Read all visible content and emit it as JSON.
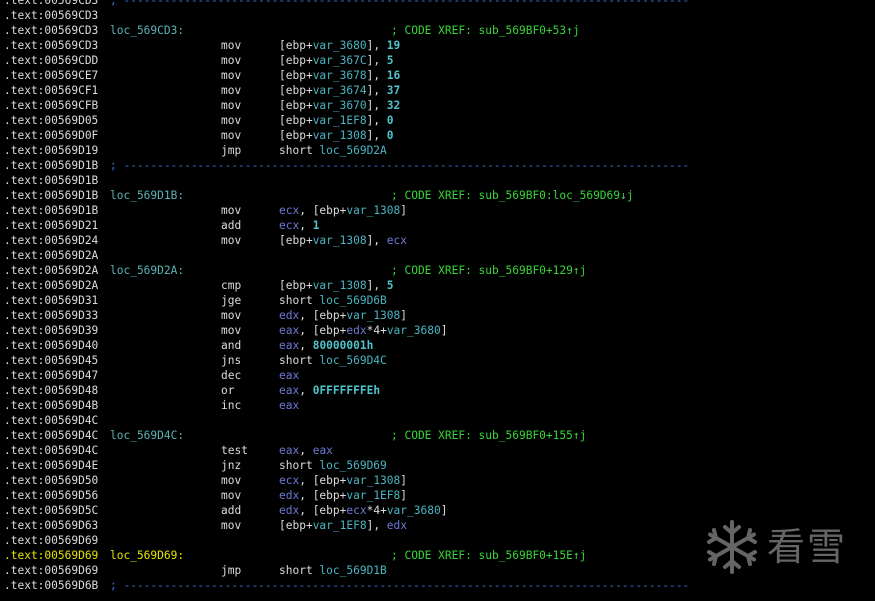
{
  "colors": {
    "background": "#000000",
    "address": "#dcdcdc",
    "address_highlight": "#e5e500",
    "label": "#5cb2b5",
    "comment": "#38d438",
    "separator": "#3b6fd1",
    "variable": "#4ab4c0",
    "number": "#4fc3c9",
    "register": "#6f78d6"
  },
  "separator_text": "; ------------------------------------------------------------------------------------",
  "lines": [
    {
      "addr": ".text:00569CD3",
      "sep": true
    },
    {
      "addr": ".text:00569CD3"
    },
    {
      "addr": ".text:00569CD3",
      "label": "loc_569CD3:",
      "comment": "; CODE XREF: sub_569BF0+53↑j"
    },
    {
      "addr": ".text:00569CD3",
      "mnem": "mov",
      "ops": [
        [
          "t-txt",
          "[ebp+"
        ],
        [
          "t-var",
          "var_3680"
        ],
        [
          "t-txt",
          "], "
        ],
        [
          "t-num",
          "19"
        ]
      ]
    },
    {
      "addr": ".text:00569CDD",
      "mnem": "mov",
      "ops": [
        [
          "t-txt",
          "[ebp+"
        ],
        [
          "t-var",
          "var_367C"
        ],
        [
          "t-txt",
          "], "
        ],
        [
          "t-num",
          "5"
        ]
      ]
    },
    {
      "addr": ".text:00569CE7",
      "mnem": "mov",
      "ops": [
        [
          "t-txt",
          "[ebp+"
        ],
        [
          "t-var",
          "var_3678"
        ],
        [
          "t-txt",
          "], "
        ],
        [
          "t-num",
          "16"
        ]
      ]
    },
    {
      "addr": ".text:00569CF1",
      "mnem": "mov",
      "ops": [
        [
          "t-txt",
          "[ebp+"
        ],
        [
          "t-var",
          "var_3674"
        ],
        [
          "t-txt",
          "], "
        ],
        [
          "t-num",
          "37"
        ]
      ]
    },
    {
      "addr": ".text:00569CFB",
      "mnem": "mov",
      "ops": [
        [
          "t-txt",
          "[ebp+"
        ],
        [
          "t-var",
          "var_3670"
        ],
        [
          "t-txt",
          "], "
        ],
        [
          "t-num",
          "32"
        ]
      ]
    },
    {
      "addr": ".text:00569D05",
      "mnem": "mov",
      "ops": [
        [
          "t-txt",
          "[ebp+"
        ],
        [
          "t-var",
          "var_1EF8"
        ],
        [
          "t-txt",
          "], "
        ],
        [
          "t-num",
          "0"
        ]
      ]
    },
    {
      "addr": ".text:00569D0F",
      "mnem": "mov",
      "ops": [
        [
          "t-txt",
          "[ebp+"
        ],
        [
          "t-var",
          "var_1308"
        ],
        [
          "t-txt",
          "], "
        ],
        [
          "t-num",
          "0"
        ]
      ]
    },
    {
      "addr": ".text:00569D19",
      "mnem": "jmp",
      "ops": [
        [
          "t-txt",
          "short "
        ],
        [
          "t-loc",
          "loc_569D2A"
        ]
      ]
    },
    {
      "addr": ".text:00569D1B",
      "sep": true
    },
    {
      "addr": ".text:00569D1B"
    },
    {
      "addr": ".text:00569D1B",
      "label": "loc_569D1B:",
      "comment": "; CODE XREF: sub_569BF0:loc_569D69↓j"
    },
    {
      "addr": ".text:00569D1B",
      "mnem": "mov",
      "ops": [
        [
          "t-reg",
          "ecx"
        ],
        [
          "t-txt",
          ", [ebp+"
        ],
        [
          "t-var",
          "var_1308"
        ],
        [
          "t-txt",
          "]"
        ]
      ]
    },
    {
      "addr": ".text:00569D21",
      "mnem": "add",
      "ops": [
        [
          "t-reg",
          "ecx"
        ],
        [
          "t-txt",
          ", "
        ],
        [
          "t-num",
          "1"
        ]
      ]
    },
    {
      "addr": ".text:00569D24",
      "mnem": "mov",
      "ops": [
        [
          "t-txt",
          "[ebp+"
        ],
        [
          "t-var",
          "var_1308"
        ],
        [
          "t-txt",
          "], "
        ],
        [
          "t-reg",
          "ecx"
        ]
      ]
    },
    {
      "addr": ".text:00569D2A"
    },
    {
      "addr": ".text:00569D2A",
      "label": "loc_569D2A:",
      "comment": "; CODE XREF: sub_569BF0+129↑j"
    },
    {
      "addr": ".text:00569D2A",
      "mnem": "cmp",
      "ops": [
        [
          "t-txt",
          "[ebp+"
        ],
        [
          "t-var",
          "var_1308"
        ],
        [
          "t-txt",
          "], "
        ],
        [
          "t-num",
          "5"
        ]
      ]
    },
    {
      "addr": ".text:00569D31",
      "mnem": "jge",
      "ops": [
        [
          "t-txt",
          "short "
        ],
        [
          "t-loc",
          "loc_569D6B"
        ]
      ]
    },
    {
      "addr": ".text:00569D33",
      "mnem": "mov",
      "ops": [
        [
          "t-reg",
          "edx"
        ],
        [
          "t-txt",
          ", [ebp+"
        ],
        [
          "t-var",
          "var_1308"
        ],
        [
          "t-txt",
          "]"
        ]
      ]
    },
    {
      "addr": ".text:00569D39",
      "mnem": "mov",
      "ops": [
        [
          "t-reg",
          "eax"
        ],
        [
          "t-txt",
          ", [ebp+"
        ],
        [
          "t-reg",
          "edx"
        ],
        [
          "t-txt",
          "*4+"
        ],
        [
          "t-var",
          "var_3680"
        ],
        [
          "t-txt",
          "]"
        ]
      ]
    },
    {
      "addr": ".text:00569D40",
      "mnem": "and",
      "ops": [
        [
          "t-reg",
          "eax"
        ],
        [
          "t-txt",
          ", "
        ],
        [
          "t-num",
          "80000001h"
        ]
      ]
    },
    {
      "addr": ".text:00569D45",
      "mnem": "jns",
      "ops": [
        [
          "t-txt",
          "short "
        ],
        [
          "t-loc",
          "loc_569D4C"
        ]
      ]
    },
    {
      "addr": ".text:00569D47",
      "mnem": "dec",
      "ops": [
        [
          "t-reg",
          "eax"
        ]
      ]
    },
    {
      "addr": ".text:00569D48",
      "mnem": "or",
      "ops": [
        [
          "t-reg",
          "eax"
        ],
        [
          "t-txt",
          ", "
        ],
        [
          "t-num",
          "0FFFFFFFEh"
        ]
      ]
    },
    {
      "addr": ".text:00569D4B",
      "mnem": "inc",
      "ops": [
        [
          "t-reg",
          "eax"
        ]
      ]
    },
    {
      "addr": ".text:00569D4C"
    },
    {
      "addr": ".text:00569D4C",
      "label": "loc_569D4C:",
      "comment": "; CODE XREF: sub_569BF0+155↑j"
    },
    {
      "addr": ".text:00569D4C",
      "mnem": "test",
      "ops": [
        [
          "t-reg",
          "eax"
        ],
        [
          "t-txt",
          ", "
        ],
        [
          "t-reg",
          "eax"
        ]
      ]
    },
    {
      "addr": ".text:00569D4E",
      "mnem": "jnz",
      "ops": [
        [
          "t-txt",
          "short "
        ],
        [
          "t-loc",
          "loc_569D69"
        ]
      ]
    },
    {
      "addr": ".text:00569D50",
      "mnem": "mov",
      "ops": [
        [
          "t-reg",
          "ecx"
        ],
        [
          "t-txt",
          ", [ebp+"
        ],
        [
          "t-var",
          "var_1308"
        ],
        [
          "t-txt",
          "]"
        ]
      ]
    },
    {
      "addr": ".text:00569D56",
      "mnem": "mov",
      "ops": [
        [
          "t-reg",
          "edx"
        ],
        [
          "t-txt",
          ", [ebp+"
        ],
        [
          "t-var",
          "var_1EF8"
        ],
        [
          "t-txt",
          "]"
        ]
      ]
    },
    {
      "addr": ".text:00569D5C",
      "mnem": "add",
      "ops": [
        [
          "t-reg",
          "edx"
        ],
        [
          "t-txt",
          ", [ebp+"
        ],
        [
          "t-reg",
          "ecx"
        ],
        [
          "t-txt",
          "*4+"
        ],
        [
          "t-var",
          "var_3680"
        ],
        [
          "t-txt",
          "]"
        ]
      ]
    },
    {
      "addr": ".text:00569D63",
      "mnem": "mov",
      "ops": [
        [
          "t-txt",
          "[ebp+"
        ],
        [
          "t-var",
          "var_1EF8"
        ],
        [
          "t-txt",
          "], "
        ],
        [
          "t-reg",
          "edx"
        ]
      ]
    },
    {
      "addr": ".text:00569D69"
    },
    {
      "addr": ".text:00569D69",
      "label": "loc_569D69:",
      "comment": "; CODE XREF: sub_569BF0+15E↑j",
      "highlight": true
    },
    {
      "addr": ".text:00569D69",
      "mnem": "jmp",
      "ops": [
        [
          "t-txt",
          "short "
        ],
        [
          "t-loc",
          "loc_569D1B"
        ]
      ]
    },
    {
      "addr": ".text:00569D6B",
      "sep": true
    }
  ],
  "watermark": {
    "text": "看雪",
    "icon": "snowflake-icon"
  }
}
